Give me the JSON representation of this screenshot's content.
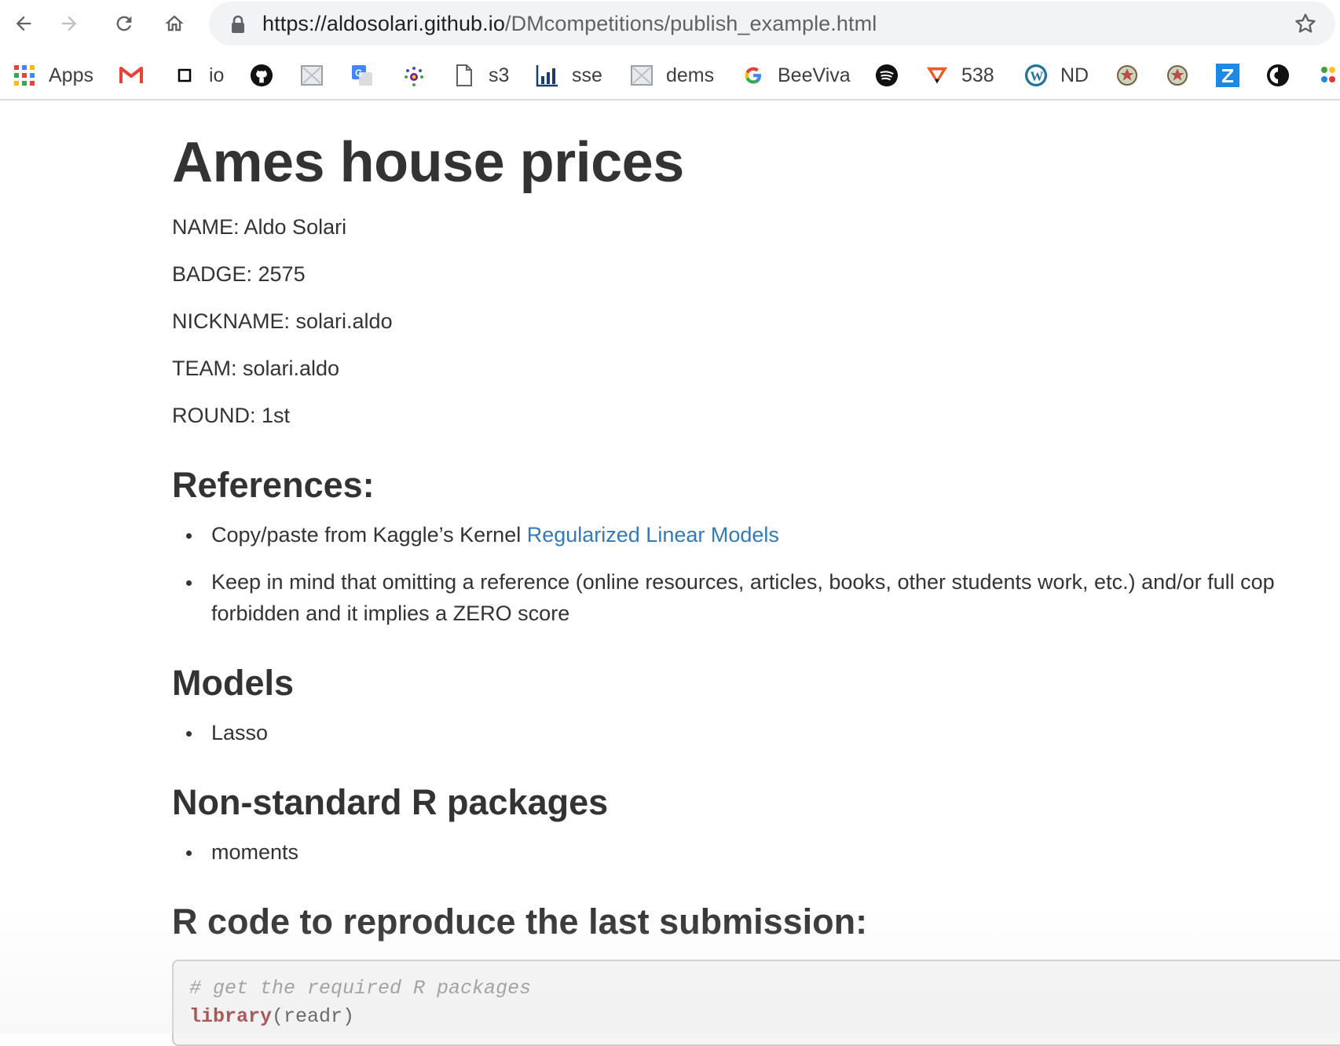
{
  "browser": {
    "url_host": "https://aldosolari.github.io",
    "url_path": "/DMcompetitions/publish_example.html",
    "back_icon": "back-arrow-icon",
    "forward_icon": "forward-arrow-icon",
    "reload_icon": "reload-icon",
    "home_icon": "home-icon",
    "lock_icon": "lock-icon",
    "star_icon": "star-icon"
  },
  "bookmarks": [
    {
      "label": "Apps",
      "icon": "apps-grid-icon"
    },
    {
      "label": "",
      "icon": "gmail-icon"
    },
    {
      "label": "io",
      "icon": "square-icon"
    },
    {
      "label": "",
      "icon": "github-icon"
    },
    {
      "label": "",
      "icon": "broken-image-icon"
    },
    {
      "label": "",
      "icon": "translate-icon"
    },
    {
      "label": "",
      "icon": "flower-icon"
    },
    {
      "label": "s3",
      "icon": "document-icon"
    },
    {
      "label": "sse",
      "icon": "chart-icon"
    },
    {
      "label": "dems",
      "icon": "broken-image-icon"
    },
    {
      "label": "BeeViva",
      "icon": "google-icon"
    },
    {
      "label": "",
      "icon": "spotify-icon"
    },
    {
      "label": "538",
      "icon": "fivethirtyeight-icon"
    },
    {
      "label": "ND",
      "icon": "wordpress-icon"
    },
    {
      "label": "",
      "icon": "emblem-icon"
    },
    {
      "label": "",
      "icon": "emblem-icon"
    },
    {
      "label": "",
      "icon": "zotero-icon"
    },
    {
      "label": "",
      "icon": "circle-logo-icon"
    },
    {
      "label": "",
      "icon": "colorful-icon"
    }
  ],
  "page": {
    "title": "Ames house prices",
    "name": "NAME: Aldo Solari",
    "badge": "BADGE: 2575",
    "nickname": "NICKNAME: solari.aldo",
    "team": "TEAM: solari.aldo",
    "round": "ROUND: 1st",
    "references_heading": "References:",
    "ref1_prefix": "Copy/paste from Kaggle’s Kernel ",
    "ref1_link": "Regularized Linear Models",
    "ref2_line1": "Keep in mind that omitting a reference (online resources, articles, books, other students work, etc.) and/or full cop",
    "ref2_line2": "forbidden and it implies a ZERO score",
    "models_heading": "Models",
    "model1": "Lasso",
    "packages_heading": "Non-standard R packages",
    "package1": "moments",
    "code_heading": "R code to reproduce the last submission:",
    "code_comment": "# get the required R packages",
    "code_keyword": "library",
    "code_args": "(readr)"
  },
  "colors": {
    "text": "#333333",
    "link": "#337ab7",
    "code_bg": "#f5f5f5",
    "code_keyword": "#8b1a1a",
    "code_comment": "#8e908c"
  }
}
